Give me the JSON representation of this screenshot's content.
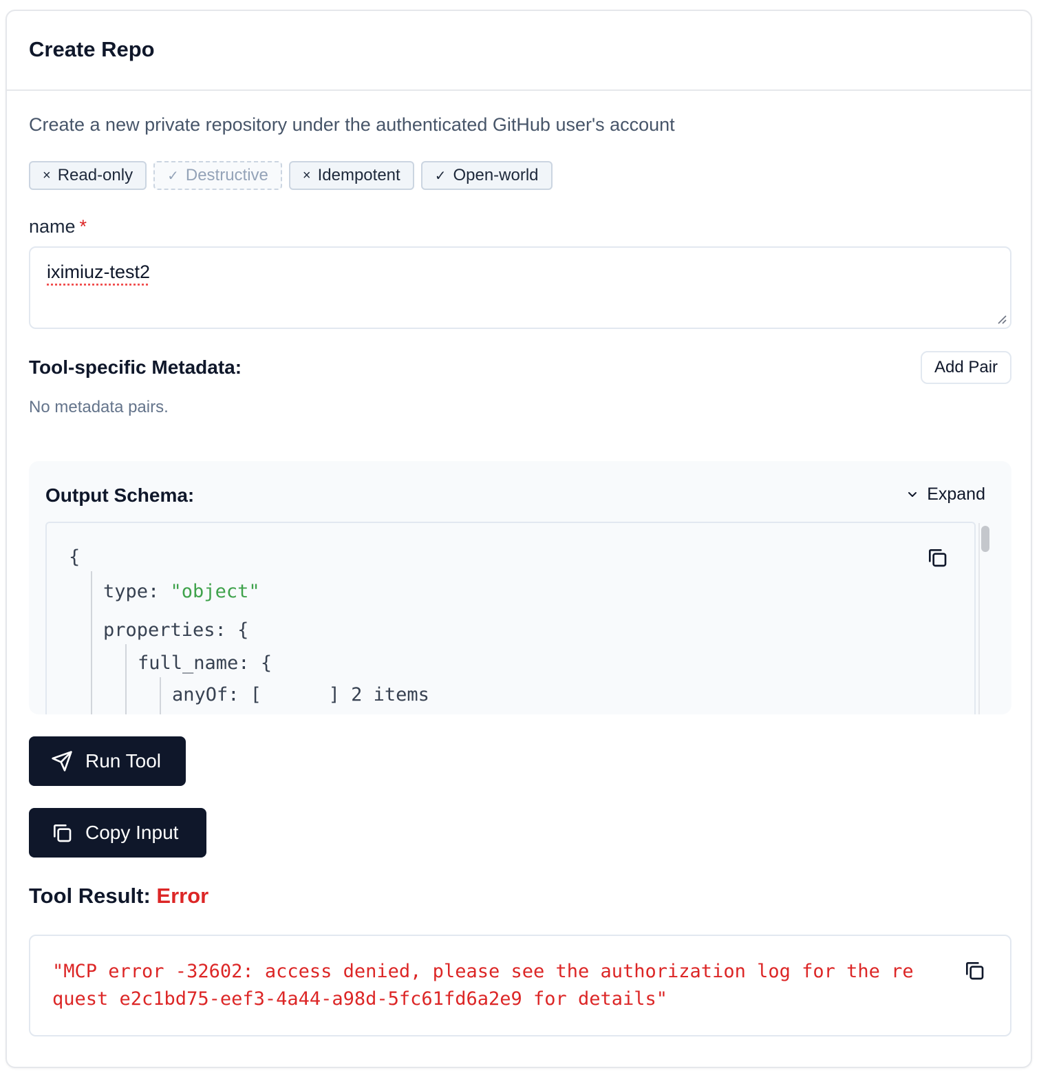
{
  "header": {
    "title": "Create Repo"
  },
  "description": "Create a new private repository under the authenticated GitHub user's account",
  "annotations": [
    {
      "mark": "×",
      "label": "Read-only",
      "state": "false"
    },
    {
      "mark": "✓",
      "label": "Destructive",
      "state": "disabled"
    },
    {
      "mark": "×",
      "label": "Idempotent",
      "state": "false"
    },
    {
      "mark": "✓",
      "label": "Open-world",
      "state": "true"
    }
  ],
  "form": {
    "name_label": "name",
    "required_mark": "*",
    "name_value": "iximiuz-test2"
  },
  "metadata": {
    "title": "Tool-specific Metadata:",
    "add_pair_label": "Add Pair",
    "empty_text": "No metadata pairs."
  },
  "schema": {
    "title": "Output Schema:",
    "expand_label": "Expand",
    "lines": {
      "open": "{",
      "type_key": "type:",
      "type_value": "\"object\"",
      "properties_key": "properties:",
      "properties_open": "{",
      "full_name_key": "full_name:",
      "full_name_open": "{",
      "anyof_line": "anyOf: [      ] 2 items"
    }
  },
  "actions": {
    "run_label": "Run Tool",
    "copy_label": "Copy Input"
  },
  "result": {
    "title": "Tool Result:",
    "status": "Error",
    "line1": "\"MCP error -32602: access denied, please see the authorization log for the re",
    "line2": "quest e2c1bd75-eef3-4a44-a98d-5fc61fd6a2e9 for details\""
  },
  "colors": {
    "error": "#dc2626",
    "primary_button": "#0f172a",
    "json_string": "#3fa24b"
  },
  "icons": [
    "x-icon",
    "check-icon",
    "chevron-down-icon",
    "copy-icon",
    "send-icon",
    "resize-grip-icon"
  ]
}
